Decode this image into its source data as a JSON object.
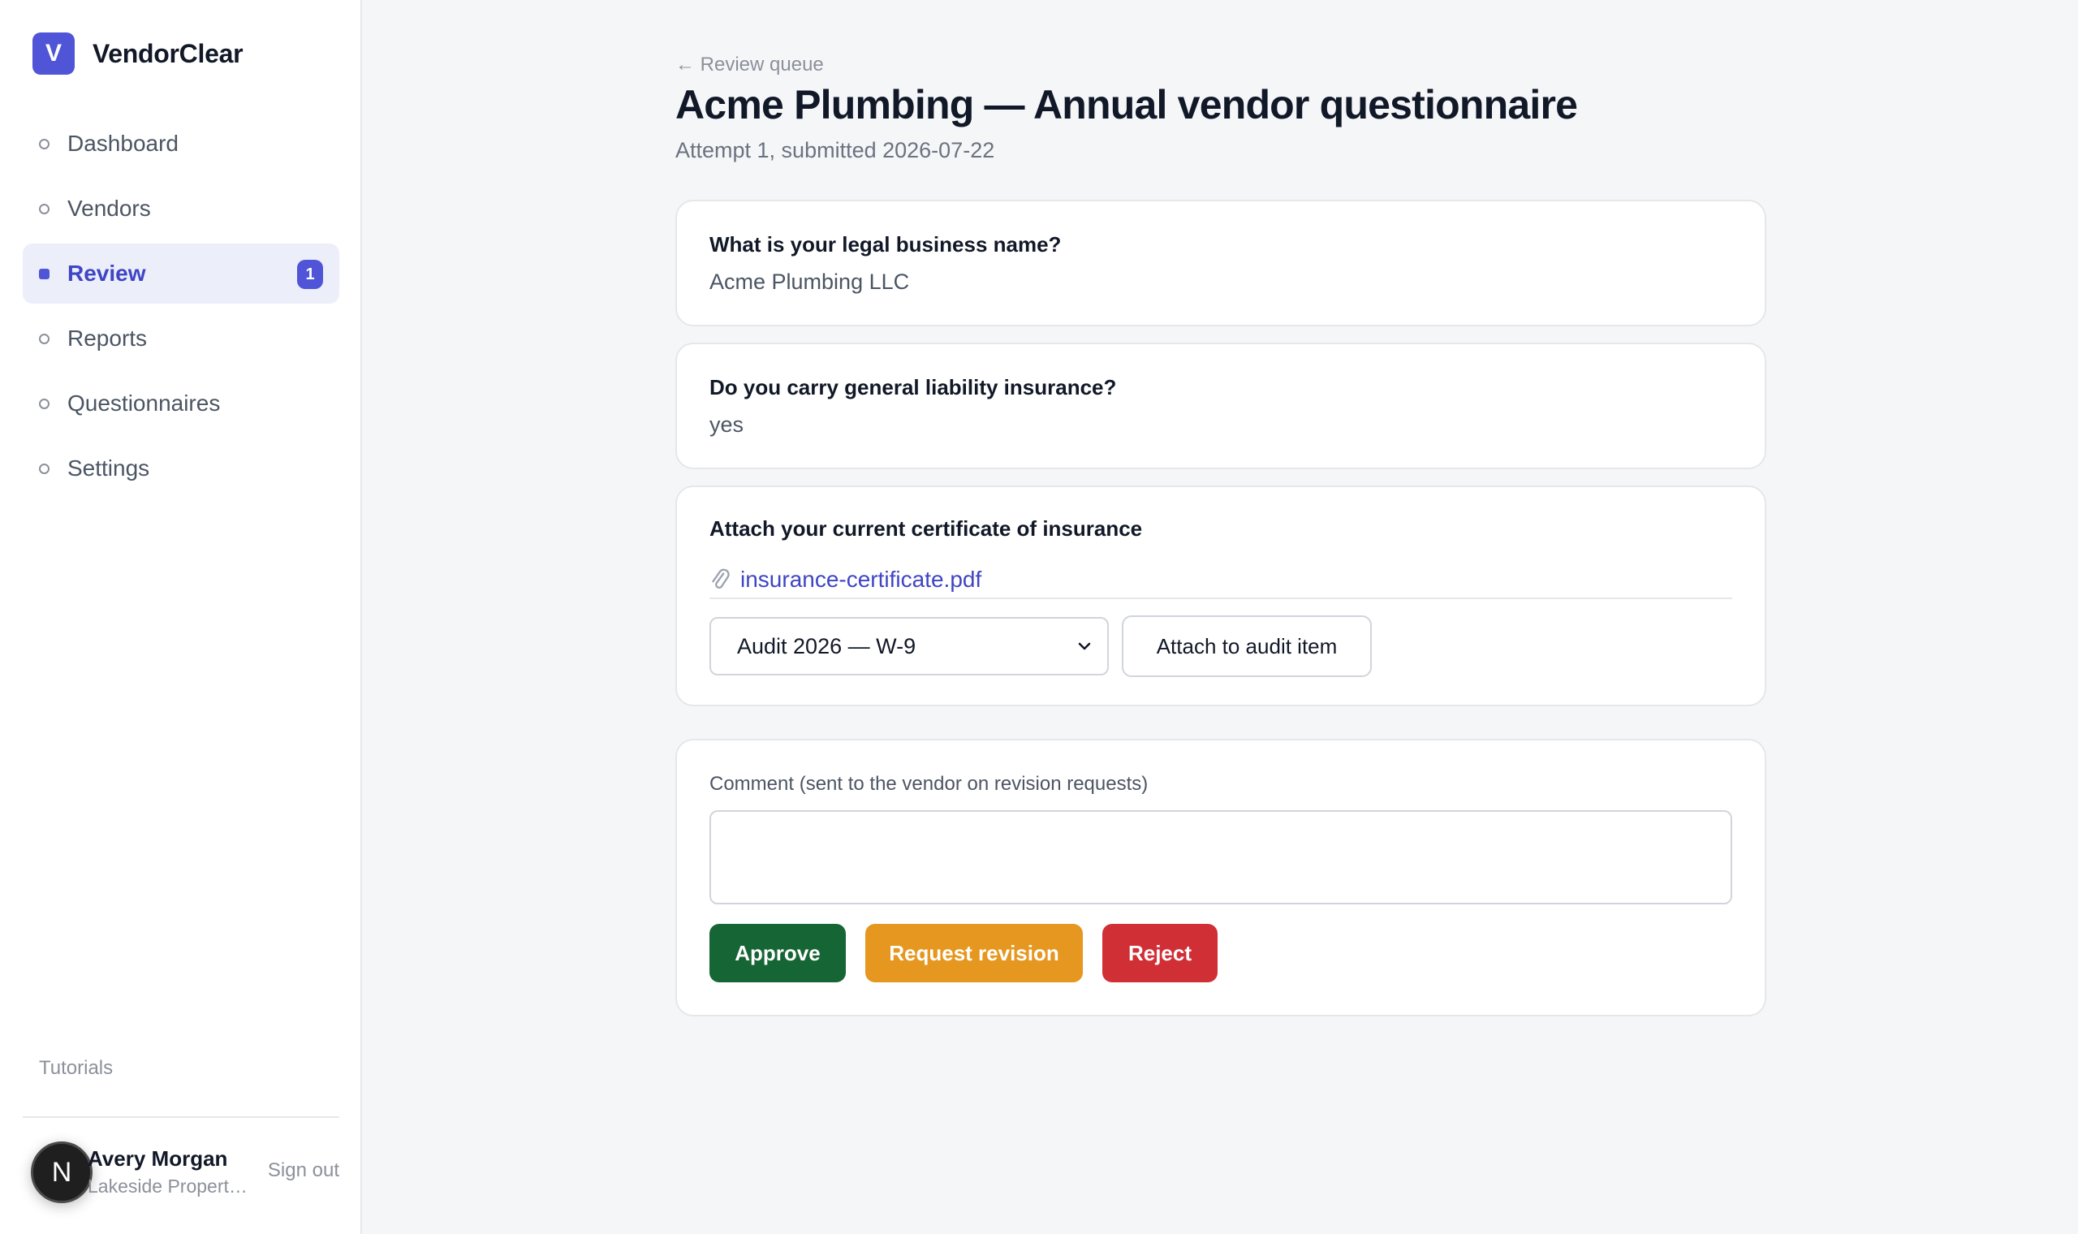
{
  "app": {
    "logo_letter": "V",
    "name": "VendorClear"
  },
  "sidebar": {
    "items": [
      {
        "label": "Dashboard",
        "active": false
      },
      {
        "label": "Vendors",
        "active": false
      },
      {
        "label": "Review",
        "active": true,
        "badge": "1"
      },
      {
        "label": "Reports",
        "active": false
      },
      {
        "label": "Questionnaires",
        "active": false
      },
      {
        "label": "Settings",
        "active": false
      }
    ],
    "tutorials_label": "Tutorials",
    "user": {
      "avatar_letter": "N",
      "name": "Avery Morgan",
      "org": "Lakeside Properties",
      "sign_out_label": "Sign out"
    }
  },
  "page": {
    "back_label": "← Review queue",
    "title": "Acme Plumbing — Annual vendor questionnaire",
    "subtitle": "Attempt 1, submitted 2026-07-22"
  },
  "questions": [
    {
      "label": "What is your legal business name?",
      "answer": "Acme Plumbing LLC"
    },
    {
      "label": "Do you carry general liability insurance?",
      "answer": "yes"
    },
    {
      "label": "Attach your current certificate of insurance",
      "file_name": "insurance-certificate.pdf",
      "audit_select_value": "Audit 2026 — W-9",
      "attach_button_label": "Attach to audit item"
    }
  ],
  "review": {
    "comment_label": "Comment (sent to the vendor on revision requests)",
    "comment_value": "",
    "approve_label": "Approve",
    "revise_label": "Request revision",
    "reject_label": "Reject"
  },
  "colors": {
    "accent": "#4f55d6",
    "approve": "#166534",
    "revise": "#e5971f",
    "reject": "#d12f36"
  },
  "icons": {
    "attachment": "paperclip-icon",
    "select": "chevron-down-icon",
    "nav_bullet": "dot-icon"
  }
}
